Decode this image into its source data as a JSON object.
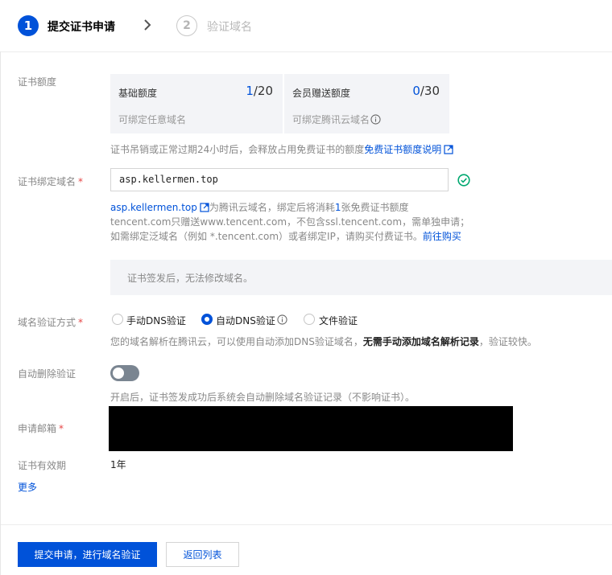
{
  "steps": [
    {
      "num": "1",
      "label": "提交证书申请"
    },
    {
      "num": "2",
      "label": "验证域名"
    }
  ],
  "quota": {
    "label": "证书额度",
    "basic": {
      "title": "基础额度",
      "used": "1",
      "total": "/20",
      "sub": "可绑定任意域名"
    },
    "member": {
      "title": "会员赠送额度",
      "used": "0",
      "total": "/30",
      "sub": "可绑定腾讯云域名"
    },
    "hint": "证书吊销或正常过期24小时后，会释放占用免费证书的额度",
    "hint_link": "免费证书额度说明"
  },
  "domain": {
    "label": "证书绑定域名",
    "required_mark": "*",
    "value": "asp.kellermen.top",
    "hint_link": "asp.kellermen.top",
    "hint_line1": "为腾讯云域名，绑定后将消耗",
    "hint_count": "1",
    "hint_line1_end": "张免费证书额度",
    "hint_line2": "tencent.com只赠送www.tencent.com，不包含ssl.tencent.com，需单独申请；",
    "hint_line3": "如需绑定泛域名（例如 *.tencent.com）或者绑定IP，请购买付费证书。",
    "buy_link": "前往购买",
    "notice": "证书签发后，无法修改域名。"
  },
  "verify": {
    "label": "域名验证方式",
    "required_mark": "*",
    "options": [
      "手动DNS验证",
      "自动DNS验证",
      "文件验证"
    ],
    "hint_prefix": "您的域名解析在腾讯云，可以使用自动添加DNS验证域名，",
    "hint_bold": "无需手动添加域名解析记录",
    "hint_suffix": "，验证较快。"
  },
  "auto_delete": {
    "label": "自动删除验证",
    "hint": "开启后，证书签发成功后系统会自动删除域名验证记录（不影响证书）。"
  },
  "email": {
    "label": "申请邮箱",
    "required_mark": "*"
  },
  "validity": {
    "label": "证书有效期",
    "value": "1年"
  },
  "more_link": "更多",
  "buttons": {
    "submit": "提交申请，进行域名验证",
    "back": "返回列表"
  },
  "colors": {
    "primary": "#0052d9",
    "success": "#00a870",
    "required": "#e54545"
  }
}
